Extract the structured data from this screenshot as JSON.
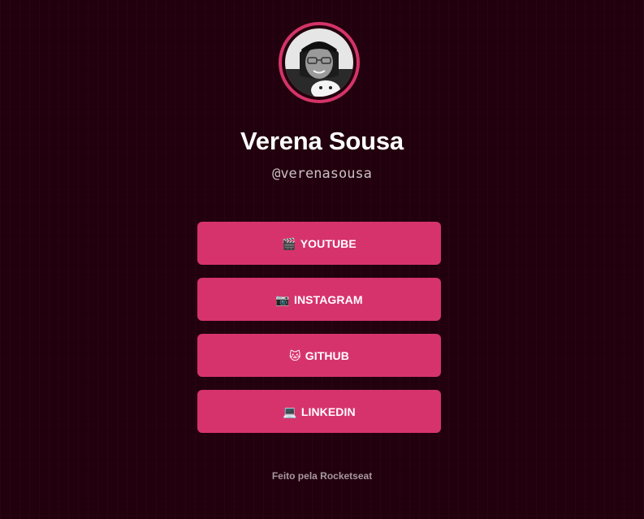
{
  "profile": {
    "name": "Verena Sousa",
    "handle": "@verenasousa"
  },
  "links": [
    {
      "emoji": "🎬",
      "label": "YOUTUBE"
    },
    {
      "emoji": "📷",
      "label": "INSTAGRAM"
    },
    {
      "emoji": "🐱",
      "label": "GITHUB"
    },
    {
      "emoji": "💻",
      "label": "LINKEDIN"
    }
  ],
  "footer": {
    "text": "Feito pela Rocketseat"
  },
  "colors": {
    "background": "#22000d",
    "accent": "#d6336c",
    "avatar_ring": "#d43468"
  }
}
